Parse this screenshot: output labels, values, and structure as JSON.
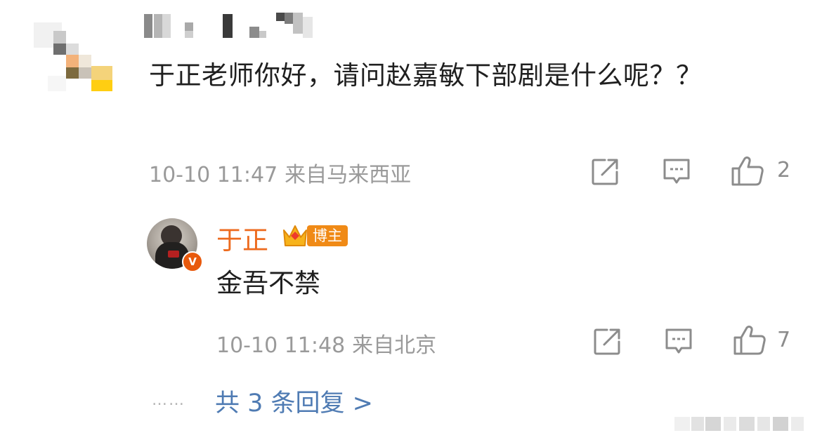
{
  "comment": {
    "text": "于正老师你好，请问赵嘉敏下部剧是什么呢？？",
    "time": "10-10 11:47",
    "location": "来自马来西亚",
    "likes": "2"
  },
  "reply": {
    "username": "于正",
    "badge_label": "博主",
    "verified_mark": "V",
    "text": "金吾不禁",
    "time": "10-10 11:48",
    "location": "来自北京",
    "likes": "7"
  },
  "thread": {
    "dots": "……",
    "more_replies": "共 3 条回复 >"
  },
  "colors": {
    "username": "#ed6b1f",
    "link": "#4f7bb3",
    "meta": "#9a9a9a",
    "badge": "#f08a16",
    "verified": "#e8590c"
  },
  "icons": [
    "share-icon",
    "comment-icon",
    "like-icon"
  ]
}
